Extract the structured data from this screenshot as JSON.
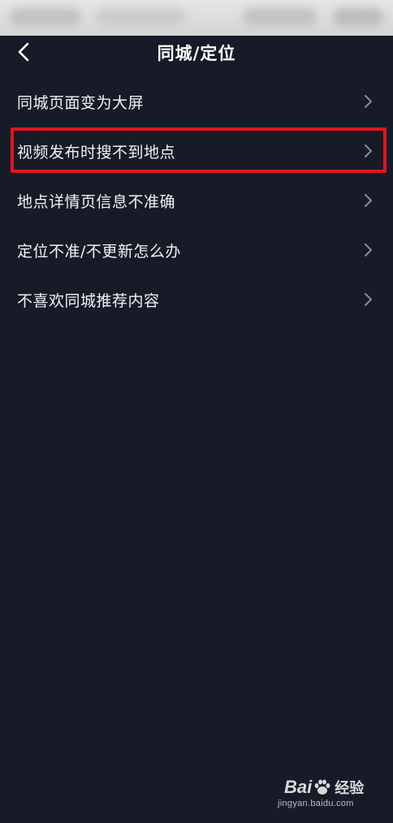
{
  "header": {
    "title": "同城/定位",
    "back_icon": "chevron-left-icon"
  },
  "menu": {
    "items": [
      {
        "label": "同城页面变为大屏",
        "icon": "chevron-right-icon"
      },
      {
        "label": "视频发布时搜不到地点",
        "icon": "chevron-right-icon",
        "highlighted": true
      },
      {
        "label": "地点详情页信息不准确",
        "icon": "chevron-right-icon"
      },
      {
        "label": "定位不准/不更新怎么办",
        "icon": "chevron-right-icon"
      },
      {
        "label": "不喜欢同城推荐内容",
        "icon": "chevron-right-icon"
      }
    ]
  },
  "watermark": {
    "brand": "Bai",
    "brand_suffix": "经验",
    "url": "jingyan.baidu.com"
  },
  "colors": {
    "background": "#171b28",
    "text": "#f2f2f4",
    "chevron": "#8a8d96",
    "highlight": "#e3141e",
    "status_bar": "#d9d9d9"
  }
}
